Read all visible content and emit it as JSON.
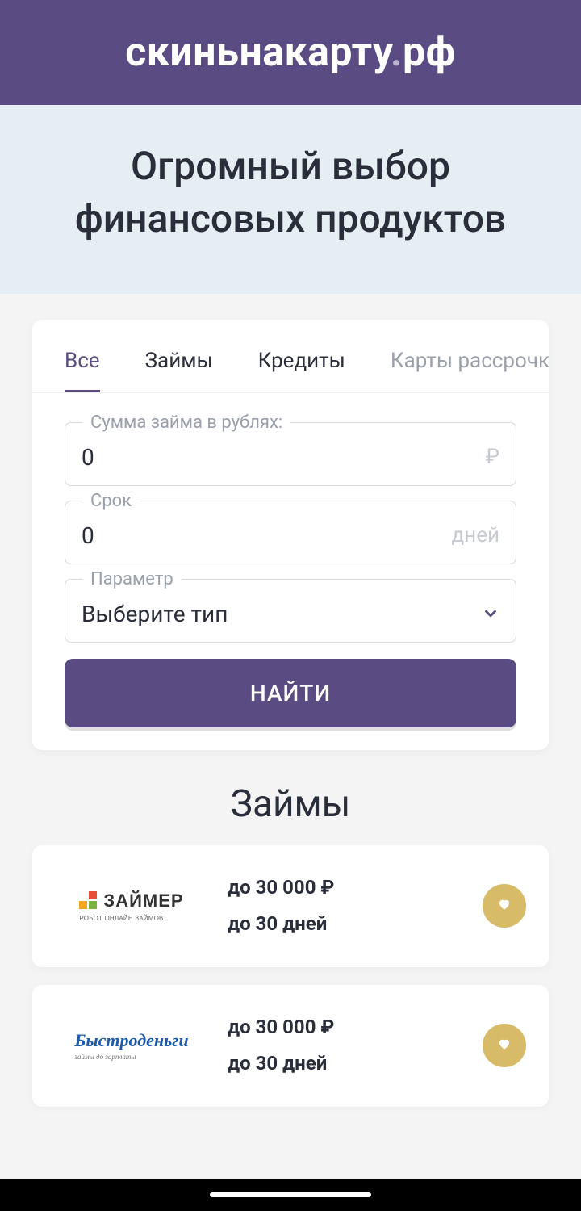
{
  "header": {
    "logo_left": "скиньнакарту",
    "logo_dot": ".",
    "logo_right": "рф"
  },
  "hero": {
    "title": "Огромный выбор финансовых продуктов"
  },
  "tabs": [
    "Все",
    "Займы",
    "Кредиты",
    "Карты рассрочки"
  ],
  "active_tab_index": 0,
  "form": {
    "amount": {
      "label": "Сумма займа в рублях:",
      "value": "0",
      "suffix": "₽"
    },
    "term": {
      "label": "Срок",
      "value": "0",
      "suffix": "дней"
    },
    "param": {
      "label": "Параметр",
      "value": "Выберите тип"
    },
    "submit": "НАЙТИ"
  },
  "section_title": "Займы",
  "offers": [
    {
      "brand": "ЗАЙМЕР",
      "brand_sub": "РОБОТ ОНЛАЙН ЗАЙМОВ",
      "amount": "до 30 000 ₽",
      "term": "до 30 дней"
    },
    {
      "brand": "Быстроденьги",
      "brand_sub": "займы до зарплаты",
      "amount": "до 30 000 ₽",
      "term": "до 30 дней"
    }
  ]
}
